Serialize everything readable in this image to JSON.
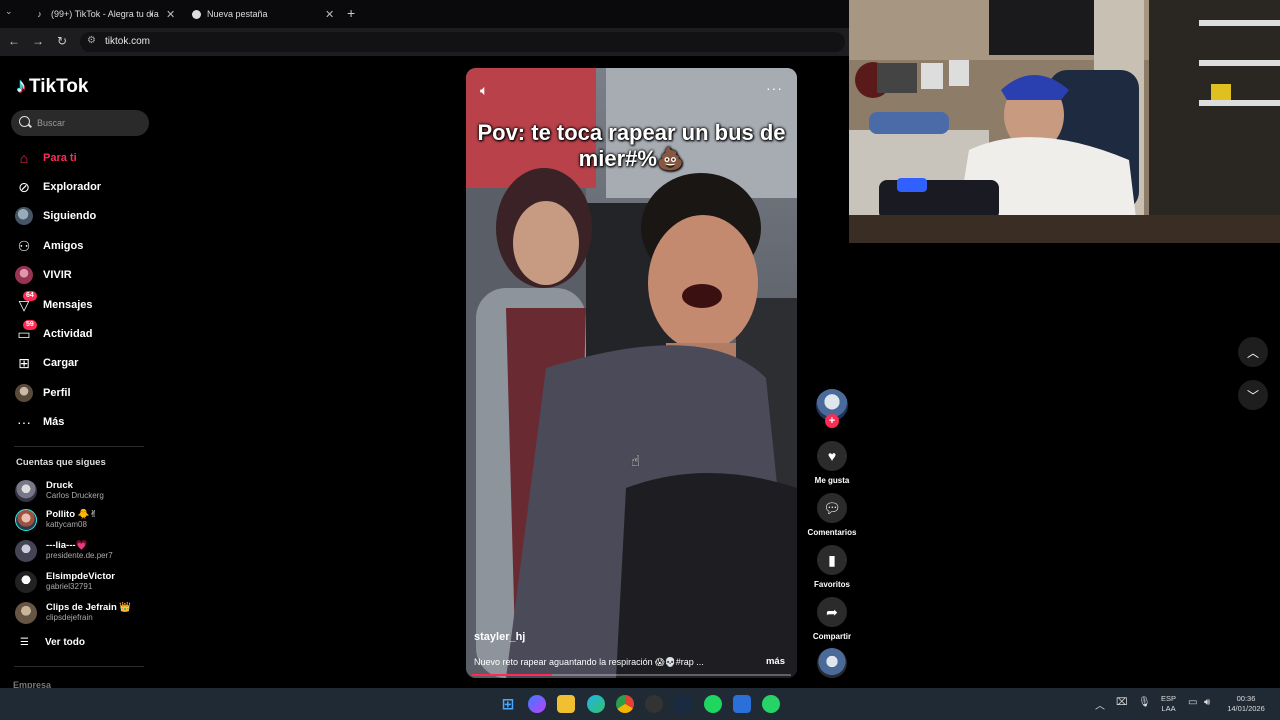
{
  "browser": {
    "tab_selector_icon": "chevron-down-icon",
    "tabs": [
      {
        "title": "(99+) TikTok - Alegra tu día",
        "icon": "tiktok-icon"
      },
      {
        "title": "Nueva pestaña",
        "icon": "chrome-icon"
      }
    ],
    "url": "tiktok.com"
  },
  "sidebar": {
    "logo_text": "TikTok",
    "search_placeholder": "Buscar",
    "nav": [
      {
        "label": "Para ti",
        "icon": "home-icon",
        "active": true
      },
      {
        "label": "Explorador",
        "icon": "compass-icon"
      },
      {
        "label": "Siguiendo",
        "icon": "following-avatar-icon"
      },
      {
        "label": "Amigos",
        "icon": "friends-icon"
      },
      {
        "label": "VIVIR",
        "icon": "live-icon"
      },
      {
        "label": "Mensajes",
        "icon": "send-icon",
        "badge": "64"
      },
      {
        "label": "Actividad",
        "icon": "inbox-icon",
        "badge": "59"
      },
      {
        "label": "Cargar",
        "icon": "upload-icon"
      },
      {
        "label": "Perfil",
        "icon": "profile-avatar-icon"
      },
      {
        "label": "Más",
        "icon": "more-icon"
      }
    ],
    "following_title": "Cuentas que sigues",
    "following": [
      {
        "name": "Druck",
        "handle": "Carlos Druckerg"
      },
      {
        "name": "Pollito 🐥✌",
        "handle": "kattycam08"
      },
      {
        "name": "---lia---💗",
        "handle": "presidente.de.per7"
      },
      {
        "name": "ElsimpdeVictor",
        "handle": "gabriel32791"
      },
      {
        "name": "Clips de Jefrain 👑",
        "handle": "clipsdejefrain"
      }
    ],
    "see_all": "Ver todo",
    "company": "Empresa"
  },
  "video": {
    "caption": "Pov: te toca rapear un bus de mier#%💩",
    "author": "stayler_hj",
    "description": "Nuevo reto rapear aguantando la respiración 😱💀#rap ...",
    "more_label": "más",
    "progress_percent": 25
  },
  "actions": [
    {
      "label": "Me gusta",
      "icon": "heart-icon"
    },
    {
      "label": "Comentarios",
      "icon": "comment-icon"
    },
    {
      "label": "Favoritos",
      "icon": "bookmark-icon"
    },
    {
      "label": "Compartir",
      "icon": "share-icon"
    }
  ],
  "taskbar": {
    "lang_1": "ESP",
    "lang_2": "LAA",
    "time": "00:36",
    "date": "14/01/2026"
  },
  "colors": {
    "accent": "#fe2c55",
    "background": "#000000",
    "taskbar": "#202a35"
  }
}
